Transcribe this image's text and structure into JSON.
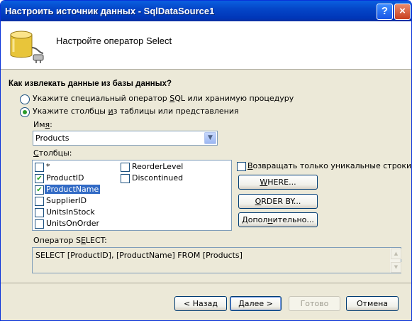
{
  "window": {
    "title": "Настроить источник данных - SqlDataSource1"
  },
  "titlebar": {
    "help": "?",
    "close": "×"
  },
  "header": {
    "title": "Настройте оператор Select"
  },
  "section": {
    "title": "Как извлекать данные из базы данных?"
  },
  "options": {
    "custom_sql_pre": "Укажите специальный оператор ",
    "custom_sql_u": "S",
    "custom_sql_post": "QL или хранимую процедуру",
    "table_pre": "Укажите столбцы ",
    "table_u": "и",
    "table_post": "з таблицы или представления",
    "selected": "table"
  },
  "name_field": {
    "label_pre": "Им",
    "label_u": "я",
    "label_post": ":",
    "value": "Products"
  },
  "columns": {
    "label_pre": "",
    "label_u": "С",
    "label_post": "толбцы:",
    "col1": [
      {
        "label": "*",
        "checked": false
      },
      {
        "label": "ProductID",
        "checked": true
      },
      {
        "label": "ProductName",
        "checked": true,
        "selected": true
      },
      {
        "label": "SupplierID",
        "checked": false
      },
      {
        "label": "UnitsInStock",
        "checked": false
      },
      {
        "label": "UnitsOnOrder",
        "checked": false
      }
    ],
    "col2": [
      {
        "label": "ReorderLevel",
        "checked": false
      },
      {
        "label": "Discontinued",
        "checked": false
      }
    ]
  },
  "unique_rows": {
    "label_u": "В",
    "label_post": "озвращать только уникальные строки"
  },
  "buttons": {
    "where_u": "W",
    "where_post": "HERE...",
    "orderby_u": "O",
    "orderby_post": "RDER BY...",
    "advanced_pre": "Допол",
    "advanced_u": "н",
    "advanced_post": "ительно..."
  },
  "sql": {
    "label_pre": "Оператор S",
    "label_u": "E",
    "label_post": "LECT:",
    "value": "SELECT [ProductID], [ProductName] FROM [Products]"
  },
  "footer": {
    "back": "< Назад",
    "next": "Далее >",
    "finish": "Готово",
    "cancel": "Отмена"
  },
  "icons": {
    "header": "database-plug-icon",
    "dropdown": "chevron-down-icon",
    "check": "checkmark-icon"
  },
  "colors": {
    "titlebar": "#0446c8",
    "selection": "#316ac5",
    "dialog": "#ece9d8"
  }
}
